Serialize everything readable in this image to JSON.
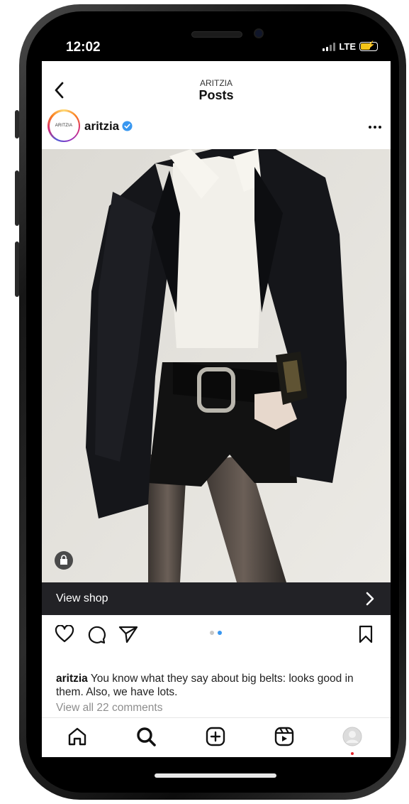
{
  "status_bar": {
    "time": "12:02",
    "network": "LTE"
  },
  "header": {
    "subtitle": "ARITZIA",
    "title": "Posts"
  },
  "post": {
    "avatar_text": "ARITZIA",
    "username": "aritzia",
    "shop_label": "View shop",
    "caption_user": "aritzia",
    "caption_text": "You know what they say about big belts: looks good in them. Also, we have lots.",
    "comments_link": "View all 22 comments",
    "carousel": {
      "count": 2,
      "active_index": 1
    }
  },
  "icons": {
    "back": "chevron-left-icon",
    "verified": "verified-badge-icon",
    "more": "more-horizontal-icon",
    "like": "heart-icon",
    "comment": "comment-icon",
    "share": "paper-plane-icon",
    "save": "bookmark-icon",
    "tabs": [
      "home-icon",
      "search-icon",
      "plus-square-icon",
      "reels-icon",
      "profile-icon"
    ]
  },
  "colors": {
    "verified": "#3897f0",
    "active_dot": "#3897f0",
    "notification_dot": "#e3262d",
    "shop_bar": "#222226"
  }
}
